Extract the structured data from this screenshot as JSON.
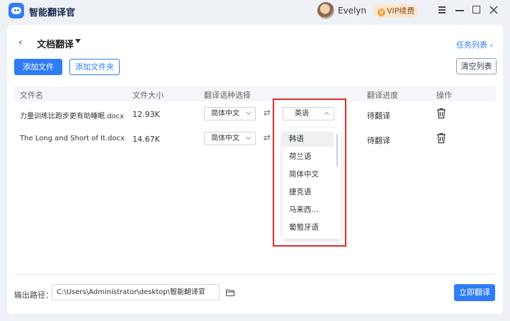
{
  "app": {
    "title": "智能翻译官",
    "user": "Evelyn",
    "vip_label": "VIP续费",
    "vip_icon": "V"
  },
  "page": {
    "back": "‹",
    "title": "文档翻译",
    "task_list": "任务列表 ›"
  },
  "toolbar": {
    "add_file": "添加文件",
    "add_folder": "添加文件夹",
    "clear_list": "清空列表"
  },
  "table": {
    "headers": [
      "文件名",
      "文件大小",
      "翻译语种选择",
      "翻译进度",
      "操作"
    ],
    "rows": [
      {
        "file": "力量训练比跑步更有助睡眠.docx",
        "size": "12.93K",
        "source_lang": "简体中文",
        "target_lang": "英语",
        "progress": "待翻译"
      },
      {
        "file": "The Long and Short of It.docx",
        "size": "14.67K",
        "source_lang": "简体中文",
        "target_lang": "",
        "progress": "待翻译"
      }
    ]
  },
  "dropdown": {
    "options": [
      "韩语",
      "荷兰语",
      "简体中文",
      "捷克语",
      "马来西...",
      "葡萄牙语"
    ]
  },
  "footer": {
    "output_label": "输出路径：",
    "output_path": "C:\\Users\\Administrator\\desktop\\智能翻译官",
    "translate_now": "立即翻译"
  },
  "colors": {
    "accent": "#2f7df6",
    "highlight_box": "#e02b2b"
  }
}
